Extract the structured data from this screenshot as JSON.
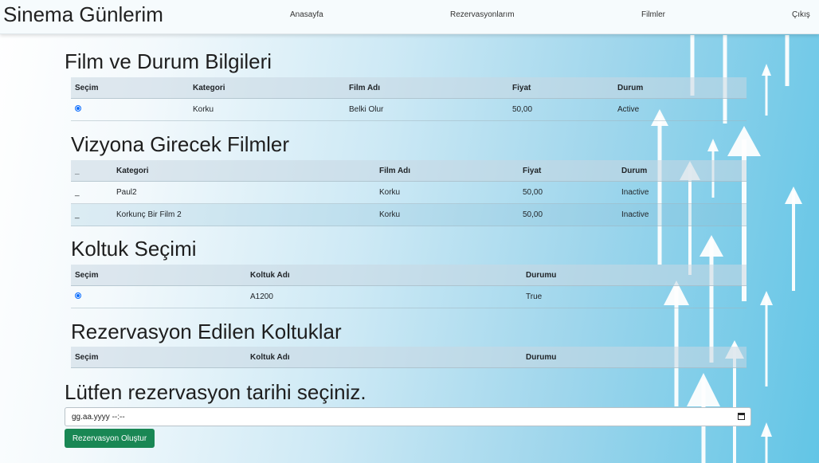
{
  "navbar": {
    "brand": "Sinema Günlerim",
    "links": [
      "Anasayfa",
      "Rezervasyonlarım",
      "Filmler",
      "Çıkış"
    ]
  },
  "film_status": {
    "title": "Film ve Durum Bilgileri",
    "columns": [
      "Seçim",
      "Kategori",
      "Film Adı",
      "Fiyat",
      "Durum"
    ],
    "rows": [
      {
        "category": "Korku",
        "film": "Belki Olur",
        "price": "50,00",
        "status": "Active",
        "selected": true
      }
    ]
  },
  "upcoming": {
    "title": "Vizyona Girecek Filmler",
    "columns": [
      "_",
      "Kategori",
      "Film Adı",
      "Fiyat",
      "Durum"
    ],
    "rows": [
      {
        "mark": "_",
        "category": "Paul2",
        "film": "Korku",
        "price": "50,00",
        "status": "Inactive"
      },
      {
        "mark": "_",
        "category": "Korkunç Bir Film 2",
        "film": "Korku",
        "price": "50,00",
        "status": "Inactive"
      }
    ]
  },
  "seat_select": {
    "title": "Koltuk Seçimi",
    "columns": [
      "Seçim",
      "Koltuk Adı",
      "Durumu"
    ],
    "rows": [
      {
        "seat": "A1200",
        "status": "True",
        "selected": true
      }
    ]
  },
  "reserved_seats": {
    "title": "Rezervasyon Edilen Koltuklar",
    "columns": [
      "Seçim",
      "Koltuk Adı",
      "Durumu"
    ]
  },
  "reservation": {
    "title": "Lütfen rezervasyon tarihi seçiniz.",
    "date_placeholder": "gg.aa.yyyy --:--",
    "button_label": "Rezervasyon Oluştur"
  },
  "colors": {
    "accent_button": "#198754",
    "radio": "#0d6efd"
  }
}
